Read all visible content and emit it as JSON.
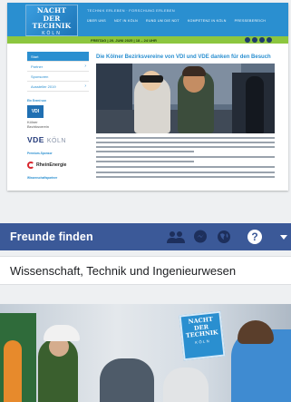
{
  "website": {
    "logo": {
      "line1": "NACHT",
      "line2": "DER",
      "line3": "TECHNIK",
      "line4": "KÖLN"
    },
    "top_links": "TECHNIK ERLEBEN · FORSCHUNG ERLEBEN",
    "nav": [
      "ÜBER UNS",
      "NDT IN KÖLN",
      "RUND UM DIE NDT",
      "KOMPETENZ IN KÖLN",
      "PRESSEBEREICH"
    ],
    "date_bar": "FREITAG | 20. JUNI 2025 | 18 – 24 UHR",
    "sidebar": {
      "items": [
        {
          "label": "Start",
          "active": true
        },
        {
          "label": "Partner",
          "chevron": true
        },
        {
          "label": "Sponsoren"
        },
        {
          "label": "Aussteller 2019",
          "chevron": true
        }
      ],
      "partner_label": "Ein Event von",
      "vdi_label": "VDI",
      "vdi_caption_1": "Kölner",
      "vdi_caption_2": "Bezirksverein",
      "vde_logo": "VDE",
      "vde_city": "KÖLN",
      "sponsor_label": "Premium-Sponsor",
      "sponsor_name": "RheinEnergie",
      "more_label": "Wissenschaftspartner"
    },
    "article_title": "Die Kölner Bezirksvereine von VDI und VDE danken für den Besuch"
  },
  "facebook": {
    "bar_title": "Freunde finden",
    "icons": [
      "friends-icon",
      "messenger-icon",
      "globe-icon",
      "help-icon",
      "caret-down-icon"
    ],
    "help_glyph": "?",
    "page_category": "Wissenschaft, Technik und Ingenieurwesen"
  },
  "cover": {
    "poster_line1": "NACHT",
    "poster_line2": "DER",
    "poster_line3": "TECHNIK",
    "poster_line4": "KÖLN"
  },
  "colors": {
    "site_blue": "#2a8fd0",
    "site_green": "#8cc63f",
    "facebook_blue": "#3b5998"
  }
}
